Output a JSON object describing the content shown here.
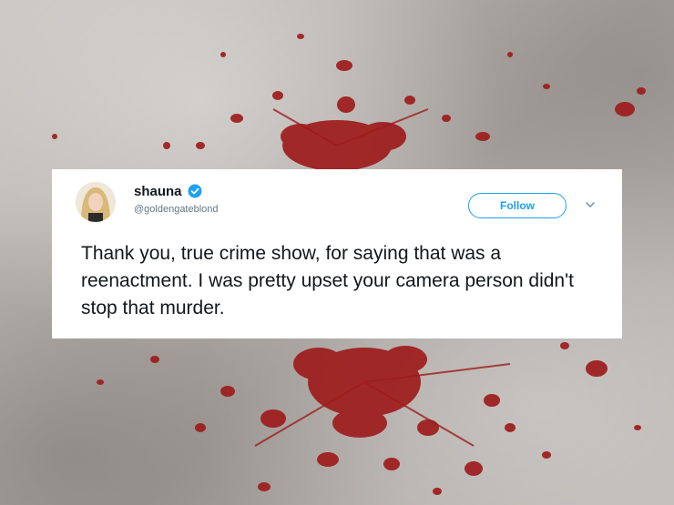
{
  "tweet": {
    "display_name": "shauna",
    "handle": "@goldengateblond",
    "verified": true,
    "follow_label": "Follow",
    "text": "Thank you, true crime show, for saying that was a reenactment. I was pretty upset your camera person didn't stop that murder."
  },
  "colors": {
    "twitter_blue": "#1da1f2",
    "blood_red": "#a01e1e",
    "text_primary": "#14171a",
    "text_secondary": "#657786"
  },
  "icons": {
    "verified": "verified-badge-icon",
    "menu": "chevron-down-icon"
  }
}
